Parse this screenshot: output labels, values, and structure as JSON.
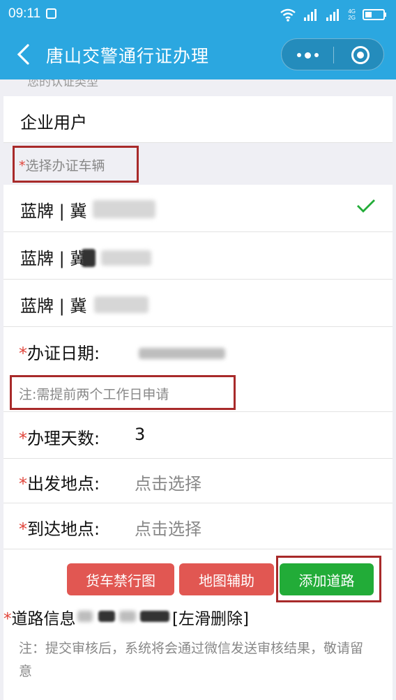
{
  "status_bar": {
    "time": "09:11",
    "network_top": "4G",
    "network_bottom": "2G"
  },
  "nav": {
    "title": "唐山交警通行证办理"
  },
  "form": {
    "cert_type_label": "您的认证类型",
    "cert_type_value": "企业用户",
    "vehicle_section_label": "选择办证车辆",
    "vehicles": [
      {
        "prefix": "蓝牌 | 冀",
        "selected": true
      },
      {
        "prefix": "蓝牌 | 冀",
        "selected": false
      },
      {
        "prefix": "蓝牌 | 冀",
        "selected": false
      }
    ],
    "date_label": "办证日期:",
    "date_hint": "注:需提前两个工作日申请",
    "days_label": "办理天数:",
    "days_value": "3",
    "origin_label": "出发地点:",
    "origin_placeholder": "点击选择",
    "dest_label": "到达地点:",
    "dest_placeholder": "点击选择",
    "required_mark": "*"
  },
  "buttons": {
    "truck_ban_map": "货车禁行图",
    "map_assist": "地图辅助",
    "add_road": "添加道路"
  },
  "road_info": {
    "label": "道路信息",
    "swipe_hint": "[左滑删除]"
  },
  "footer_note": "注：提交审核后，系统将会通过微信发送审核结果，敬请留意",
  "colors": {
    "header_blue": "#2ba7e0",
    "required_red": "#e0443a",
    "button_red": "#e15752",
    "button_green": "#22ac38",
    "check_green": "#22ac38",
    "annotation_box": "#a82a2a"
  },
  "icons": {
    "back": "chevron-left-icon",
    "more": "more-dots-icon",
    "close": "target-close-icon",
    "check": "checkmark-icon"
  }
}
